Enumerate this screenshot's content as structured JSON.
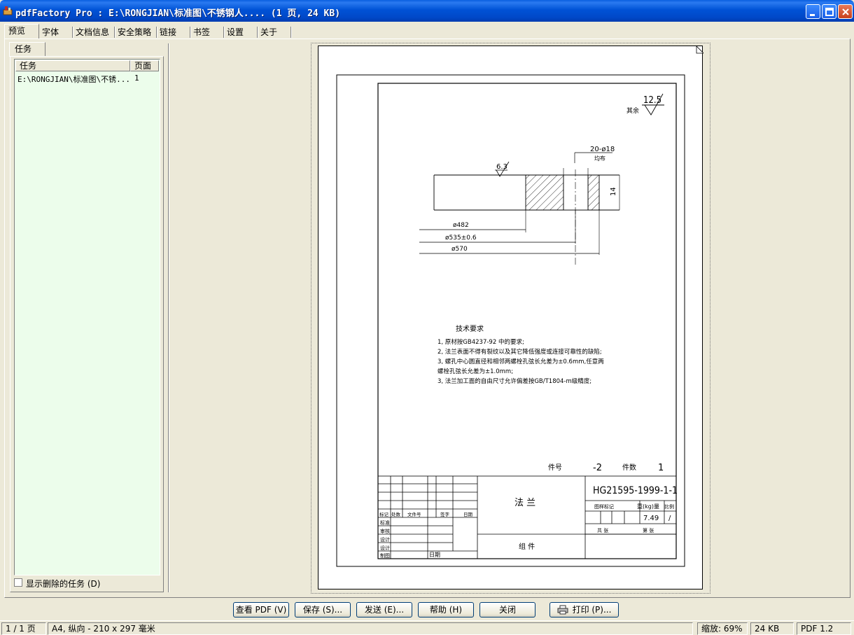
{
  "window": {
    "title": "pdfFactory Pro : E:\\RONGJIAN\\标准图\\不锈钢人....  (1 页, 24 KB)"
  },
  "tabs": [
    {
      "label": "预览",
      "active": true
    },
    {
      "label": "字体"
    },
    {
      "label": "文档信息"
    },
    {
      "label": "安全策略"
    },
    {
      "label": "链接"
    },
    {
      "label": "书签"
    },
    {
      "label": "设置"
    },
    {
      "label": "关于"
    }
  ],
  "left_panel": {
    "tab_label": "任务",
    "columns": [
      "任务",
      "页面"
    ],
    "rows": [
      {
        "task": "E:\\RONGJIAN\\标准图\\不锈...",
        "page": "1"
      }
    ],
    "show_deleted_label": "显示删除的任务 (D)",
    "show_deleted_checked": false
  },
  "drawing": {
    "roughness_corner": "12.5",
    "roughness_corner_note": "其余",
    "roughness_face": "6.3",
    "holes_label": "20-ø18",
    "holes_note": "均布",
    "thickness": "14",
    "dim_1": "ø482",
    "dim_2": "ø535±0.6",
    "dim_3": "ø570",
    "tech_title": "技术要求",
    "tech_lines": [
      "1, 原材按GB4237-92 中的要求;",
      "2, 法兰表面不得有裂纹以及其它降低强度或连接可靠性的缺陷;",
      "3, 螺孔中心圆直径和相邻两螺栓孔弦长允差为±0.6mm,任意两",
      "   螺栓孔弦长允差为±1.0mm;",
      "3, 法兰加工面的自由尺寸允许偏差按GB/T1804-m级精度;"
    ],
    "part_no_label": "件号",
    "part_no": "-2",
    "qty_label": "件数",
    "qty": "1",
    "drawing_no": "HG21595-1999-1-1",
    "part_name": "法 兰",
    "assembly": "组 件",
    "tb_mark_cols": [
      "标记",
      "处数",
      "文件号",
      "签字",
      "日期"
    ],
    "tb_left_rows": [
      "标准",
      "审核",
      "设计",
      "设计",
      "制图"
    ],
    "tb_date_label": "日期",
    "tb_stage_label": "图样标记",
    "tb_weight_label": "重(kg)量",
    "tb_scale_label": "比例",
    "weight": "7.49",
    "scale": "/",
    "tb_total_label": "共 张",
    "tb_sheet_label": "第 张"
  },
  "buttons": [
    {
      "label": "查看 PDF (V)"
    },
    {
      "label": "保存 (S)..."
    },
    {
      "label": "发送 (E)..."
    },
    {
      "label": "帮助 (H)"
    },
    {
      "label": "关闭"
    },
    {
      "label": "打印 (P)...",
      "icon": "printer-icon"
    }
  ],
  "status": {
    "page": "1 / 1 页",
    "paper": "A4, 纵向 - 210 x 297 毫米",
    "zoom": "缩放: 69%",
    "size": "24 KB",
    "pdf_version": "PDF 1.2"
  }
}
